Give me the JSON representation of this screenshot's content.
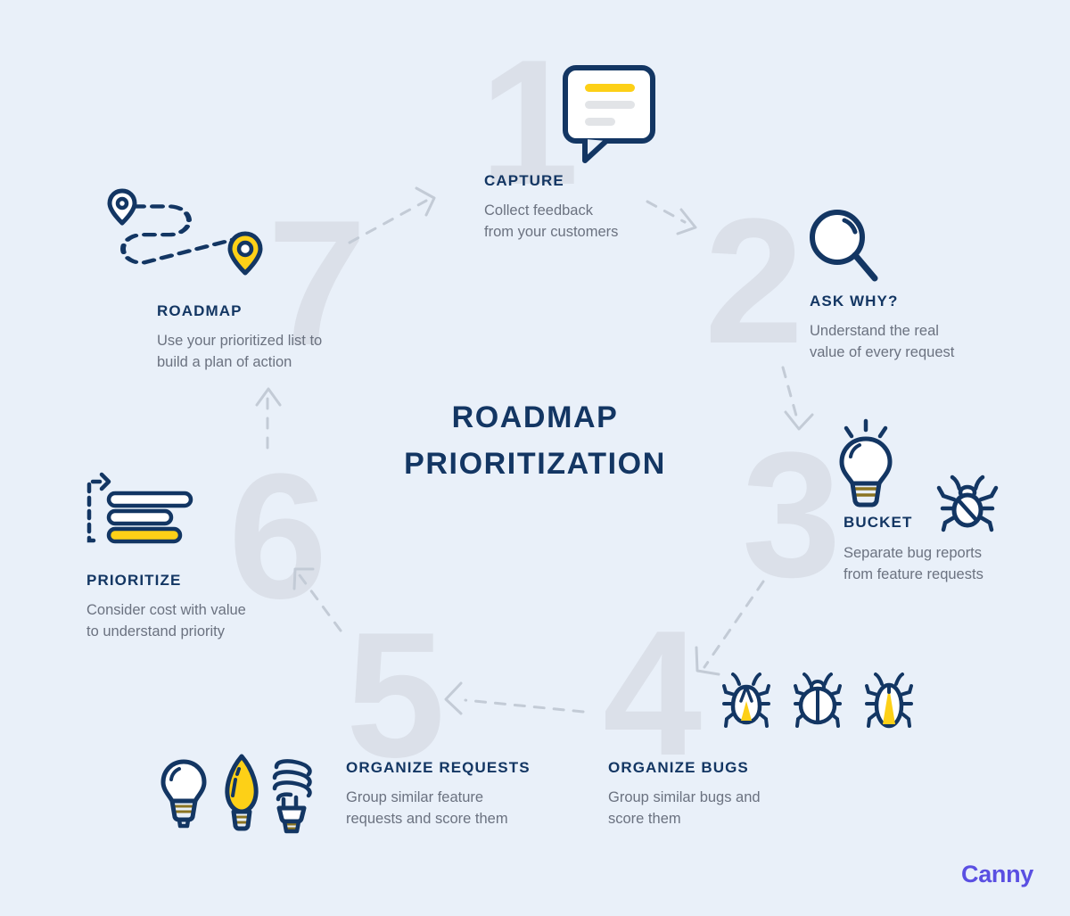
{
  "page": {
    "background_color": "#e9f0f9",
    "title_line1": "ROADMAP",
    "title_line2": "PRIORITIZATION",
    "brand": "Canny"
  },
  "colors": {
    "navy": "#133663",
    "yellow": "#fdd017",
    "grey_number": "#dbe0e9",
    "body_text": "#6b7280",
    "arrow": "#c3cbd6",
    "brand_purple": "#5a4fe2",
    "light_grey_line": "#e2e4e7"
  },
  "steps": [
    {
      "number": "1",
      "heading": "CAPTURE",
      "desc_line1": "Collect feedback",
      "desc_line2": "from your customers",
      "icon": "speech-bubble-icon"
    },
    {
      "number": "2",
      "heading": "ASK WHY?",
      "desc_line1": "Understand the real",
      "desc_line2": "value of every request",
      "icon": "magnifying-glass-icon"
    },
    {
      "number": "3",
      "heading": "BUCKET",
      "desc_line1": "Separate bug reports",
      "desc_line2": "from feature requests",
      "icon": "lightbulb-and-bug-icon"
    },
    {
      "number": "4",
      "heading": "ORGANIZE BUGS",
      "desc_line1": "Group similar bugs and",
      "desc_line2": "score them",
      "icon": "three-bugs-icon"
    },
    {
      "number": "5",
      "heading": "ORGANIZE REQUESTS",
      "desc_line1": "Group similar feature",
      "desc_line2": "requests and score them",
      "icon": "three-lightbulbs-icon"
    },
    {
      "number": "6",
      "heading": "PRIORITIZE",
      "desc_line1": "Consider cost with value",
      "desc_line2": "to understand priority",
      "icon": "ranked-list-icon"
    },
    {
      "number": "7",
      "heading": "ROADMAP",
      "desc_line1": "Use your prioritized list to",
      "desc_line2": "build a plan of action",
      "icon": "route-pins-icon"
    }
  ]
}
